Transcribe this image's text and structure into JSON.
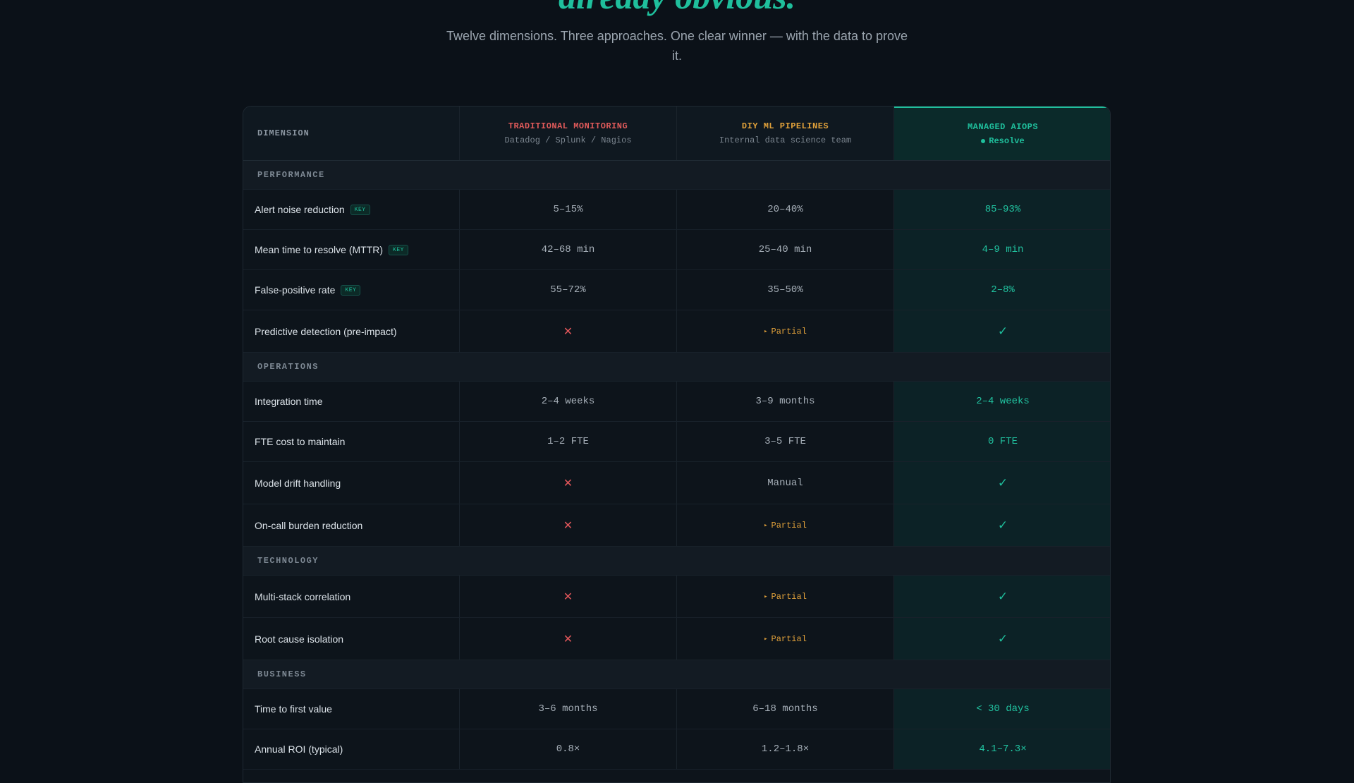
{
  "hero": {
    "headline": "already obvious.",
    "subtitle": "Twelve dimensions. Three approaches. One clear winner — with the data to prove it."
  },
  "table": {
    "header": {
      "dimension": "DIMENSION",
      "traditional": {
        "title": "TRADITIONAL MONITORING",
        "subtitle": "Datadog / Splunk / Nagios"
      },
      "diy": {
        "title": "DIY ML PIPELINES",
        "subtitle": "Internal data science team"
      },
      "managed": {
        "title": "MANAGED AIOPS",
        "brand": "Resolve"
      }
    },
    "badge_label": "KEY",
    "partial_label": "Partial",
    "partial_arrow": "▸",
    "cross_glyph": "✕",
    "check_glyph": "✓",
    "sections": {
      "performance": "PERFORMANCE",
      "operations": "OPERATIONS",
      "technology": "TECHNOLOGY",
      "business": "BUSINESS"
    },
    "rows": {
      "alert_noise": {
        "label": "Alert noise reduction",
        "traditional": "5–15%",
        "diy": "20–40%",
        "managed": "85–93%"
      },
      "mttr": {
        "label": "Mean time to resolve (MTTR)",
        "traditional": "42–68 min",
        "diy": "25–40 min",
        "managed": "4–9 min"
      },
      "false_positive": {
        "label": "False-positive rate",
        "traditional": "55–72%",
        "diy": "35–50%",
        "managed": "2–8%"
      },
      "predictive": {
        "label": "Predictive detection (pre-impact)"
      },
      "integration": {
        "label": "Integration time",
        "traditional": "2–4 weeks",
        "diy": "3–9 months",
        "managed": "2–4 weeks"
      },
      "fte": {
        "label": "FTE cost to maintain",
        "traditional": "1–2 FTE",
        "diy": "3–5 FTE",
        "managed": "0 FTE"
      },
      "drift": {
        "label": "Model drift handling",
        "diy": "Manual"
      },
      "oncall": {
        "label": "On-call burden reduction"
      },
      "multistack": {
        "label": "Multi-stack correlation"
      },
      "rootcause": {
        "label": "Root cause isolation"
      },
      "first_value": {
        "label": "Time to first value",
        "traditional": "3–6 months",
        "diy": "6–18 months",
        "managed": "< 30 days"
      },
      "roi": {
        "label": "Annual ROI (typical)",
        "traditional": "0.8×",
        "diy": "1.2–1.8×",
        "managed": "4.1–7.3×"
      }
    }
  },
  "colors": {
    "accent": "#1fbf9c",
    "traditional": "#e05a5a",
    "diy": "#e1a13a",
    "background": "#0b1118"
  }
}
